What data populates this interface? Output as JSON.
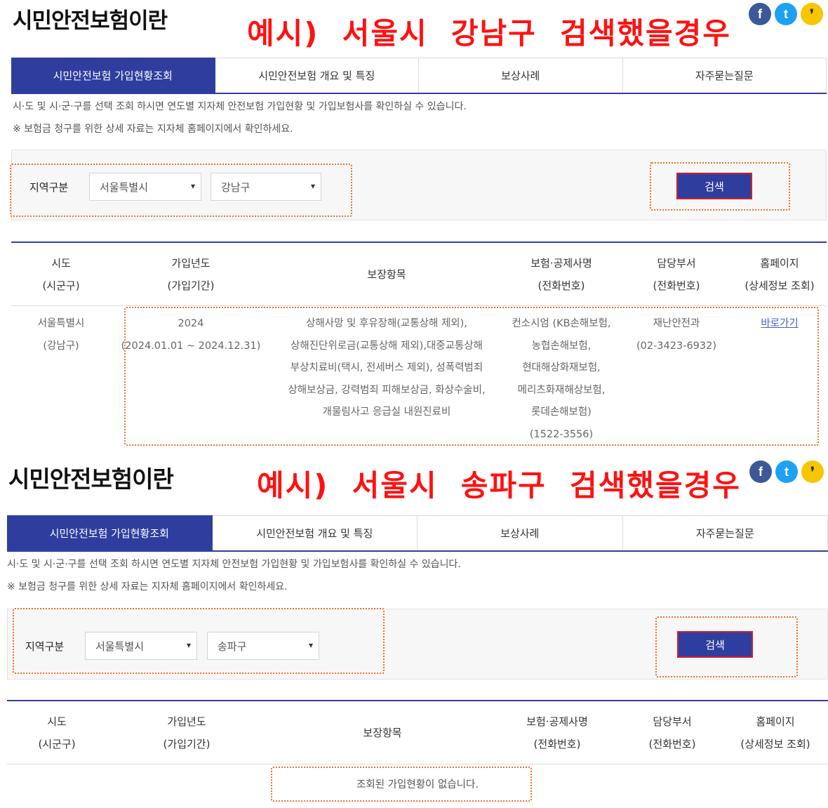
{
  "brand": {
    "title_color": "#111111",
    "active_tab": "#2f3e9e",
    "caption_color": "#ff1111",
    "highlight": "#e8742a"
  },
  "social": [
    {
      "icon": "facebook-icon",
      "glyph": "f"
    },
    {
      "icon": "twitter-icon",
      "glyph": "t"
    },
    {
      "icon": "kakaostory-icon",
      "glyph": "❜"
    }
  ],
  "panel1": {
    "page_title": "시민안전보험이란",
    "caption": "예시)  서울시  강남구  검색했을경우",
    "tabs": [
      "시민안전보험 가입현황조회",
      "시민안전보험 개요 및 특징",
      "보상사례",
      "자주묻는질문"
    ],
    "desc1": "시·도 및 시·군·구를 선택 조회 하시면 연도별 지자체 안전보험 가입현황 및 가입보험사를 확인하실 수 있습니다.",
    "desc2": "※ 보험금 청구를 위한 상세 자료는 지자체 홈페이지에서 확인하세요.",
    "region_label": "지역구분",
    "sido": "서울특별시",
    "sigungu": "강남구",
    "search_label": "검색",
    "headers": [
      {
        "line1": "시도",
        "line2": "(시군구)"
      },
      {
        "line1": "가입년도",
        "line2": "(가입기간)"
      },
      {
        "line1": "보장항목",
        "line2": ""
      },
      {
        "line1": "보험·공제사명",
        "line2": "(전화번호)"
      },
      {
        "line1": "담당부서",
        "line2": "(전화번호)"
      },
      {
        "line1": "홈페이지",
        "line2": "(상세정보 조회)"
      }
    ],
    "row": {
      "region": [
        "서울특별시",
        "(강남구)"
      ],
      "year": [
        "2024",
        "(2024.01.01 ~ 2024.12.31)"
      ],
      "coverage": [
        "상해사망 및 후유장해(교통상해 제외),",
        "상해진단위로금(교통상해 제외),대중교통상해",
        "부상치료비(택시, 전세버스 제외), 성폭력범죄",
        "상해보상금, 강력범죄 피해보상금, 화상수술비,",
        "개물림사고 응급실 내원진료비"
      ],
      "insurer": [
        "컨소시엄 (KB손해보험,",
        "농협손해보험,",
        "현대해상화재보험,",
        "메리츠화재해상보험,",
        "롯데손해보험)",
        "(1522-3556)"
      ],
      "dept": [
        "재난안전과",
        "(02-3423-6932)"
      ],
      "link": "바로가기"
    }
  },
  "panel2": {
    "page_title": "시민안전보험이란",
    "caption": "예시)  서울시  송파구  검색했을경우",
    "tabs": [
      "시민안전보험 가입현황조회",
      "시민안전보험 개요 및 특징",
      "보상사례",
      "자주묻는질문"
    ],
    "desc1": "시·도 및 시·군·구를 선택 조회 하시면 연도별 지자체 안전보험 가입현황 및 가입보험사를 확인하실 수 있습니다.",
    "desc2": "※ 보험금 청구를 위한 상세 자료는 지자체 홈페이지에서 확인하세요.",
    "region_label": "지역구분",
    "sido": "서울특별시",
    "sigungu": "송파구",
    "search_label": "검색",
    "headers": [
      {
        "line1": "시도",
        "line2": "(시군구)"
      },
      {
        "line1": "가입년도",
        "line2": "(가입기간)"
      },
      {
        "line1": "보장항목",
        "line2": ""
      },
      {
        "line1": "보험·공제사명",
        "line2": "(전화번호)"
      },
      {
        "line1": "담당부서",
        "line2": "(전화번호)"
      },
      {
        "line1": "홈페이지",
        "line2": "(상세정보 조회)"
      }
    ],
    "empty_message": "조회된 가입현황이 없습니다."
  }
}
